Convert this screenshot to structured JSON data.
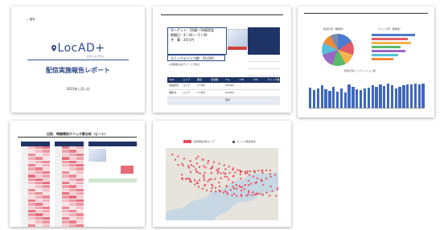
{
  "slide1": {
    "corner_text": "― 屋号",
    "logo_text": "LocAD+",
    "logo_sub": "ロカッドプラス",
    "title": "配信実施報告レポート",
    "date": "2023年○月○日"
  },
  "slide2": {
    "info_lines": [
      "ターゲット：20歳〜30歳男女",
      "期間日：4 / 30 〜 5 / 30",
      "予　算：20万円"
    ],
    "impressions": "ユニークデバイス数：20,000",
    "note": "※施策数は表示ベースで集計",
    "table_headers": [
      "Web",
      "エリア",
      "期間",
      "配信数",
      "imp",
      "CTR",
      "CPC",
      "クリック数"
    ],
    "table_rows": [
      [
        "渋谷区内",
        "エリア",
        "1〜8日",
        "",
        "20,000",
        "",
        "",
        ""
      ],
      [
        "港区内",
        "エリア",
        "1〜8日",
        "",
        "20,000",
        "",
        "",
        ""
      ],
      [
        "",
        "",
        "",
        "",
        "合計",
        "",
        "",
        ""
      ]
    ]
  },
  "slide3": {
    "pie_caption": "配信比率（業種別）",
    "bar_caption": "クリック率（業種別）",
    "vbar_caption": "配信日別インプレッション数",
    "vbar_values": [
      0.62,
      0.55,
      0.6,
      0.7,
      0.58,
      0.52,
      0.66,
      0.5,
      0.6,
      0.48,
      0.72,
      0.64,
      0.58,
      0.54,
      0.6,
      0.62,
      0.7,
      0.66,
      0.72,
      0.68,
      0.74,
      0.7,
      0.6,
      0.64,
      0.7,
      0.72,
      0.73,
      0.74,
      0.72,
      0.75
    ],
    "hbar_colors": [
      "#4a7bd1",
      "#e25b6a",
      "#f4b44c",
      "#59b96a",
      "#9b67c9",
      "#58c0d8",
      "#f08a3a"
    ],
    "hbar_values": [
      0.9,
      0.75,
      0.82,
      0.6,
      0.7,
      0.55,
      0.45
    ]
  },
  "slide4": {
    "title": "日別、時間帯別クリック数分析（ヒート）"
  },
  "slide5": {
    "legend_a": "広告配信対象エリア",
    "legend_b": "クリック発生地点"
  }
}
